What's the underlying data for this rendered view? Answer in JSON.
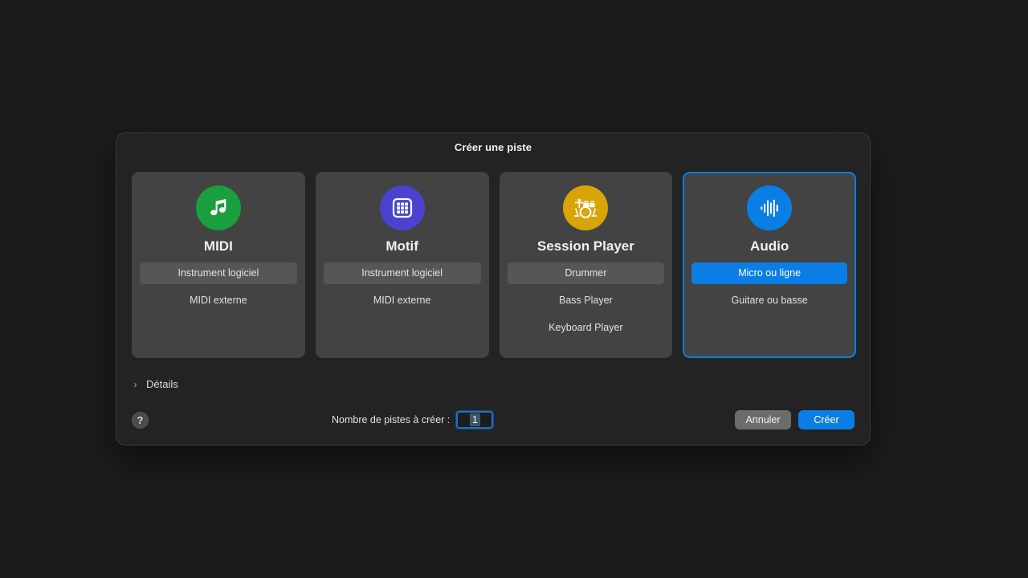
{
  "dialog": {
    "title": "Créer une piste"
  },
  "cards": [
    {
      "id": "midi",
      "title": "MIDI",
      "icon": "music-note-icon",
      "icon_color": "#1a9e3e",
      "selected": false,
      "options": [
        {
          "label": "Instrument logiciel",
          "state": "hover"
        },
        {
          "label": "MIDI externe",
          "state": "normal"
        }
      ]
    },
    {
      "id": "motif",
      "title": "Motif",
      "icon": "grid-pattern-icon",
      "icon_color": "#4a43cf",
      "selected": false,
      "options": [
        {
          "label": "Instrument logiciel",
          "state": "hover"
        },
        {
          "label": "MIDI externe",
          "state": "normal"
        }
      ]
    },
    {
      "id": "session-player",
      "title": "Session Player",
      "icon": "drum-kit-icon",
      "icon_color": "#d9a408",
      "selected": false,
      "options": [
        {
          "label": "Drummer",
          "state": "hover"
        },
        {
          "label": "Bass Player",
          "state": "normal"
        },
        {
          "label": "Keyboard Player",
          "state": "normal"
        }
      ]
    },
    {
      "id": "audio",
      "title": "Audio",
      "icon": "waveform-icon",
      "icon_color": "#0a7ee4",
      "selected": true,
      "options": [
        {
          "label": "Micro ou ligne",
          "state": "active"
        },
        {
          "label": "Guitare ou basse",
          "state": "normal"
        }
      ]
    }
  ],
  "details": {
    "label": "Détails",
    "disclosure_glyph": "›",
    "expanded": false
  },
  "footer": {
    "help_glyph": "?",
    "count_label": "Nombre de pistes à créer :",
    "count_value": "1",
    "cancel_label": "Annuler",
    "create_label": "Créer"
  },
  "colors": {
    "accent": "#0a7ee4",
    "dialog_bg": "#232323",
    "card_bg": "#434343",
    "page_bg": "#1c1c1c"
  }
}
